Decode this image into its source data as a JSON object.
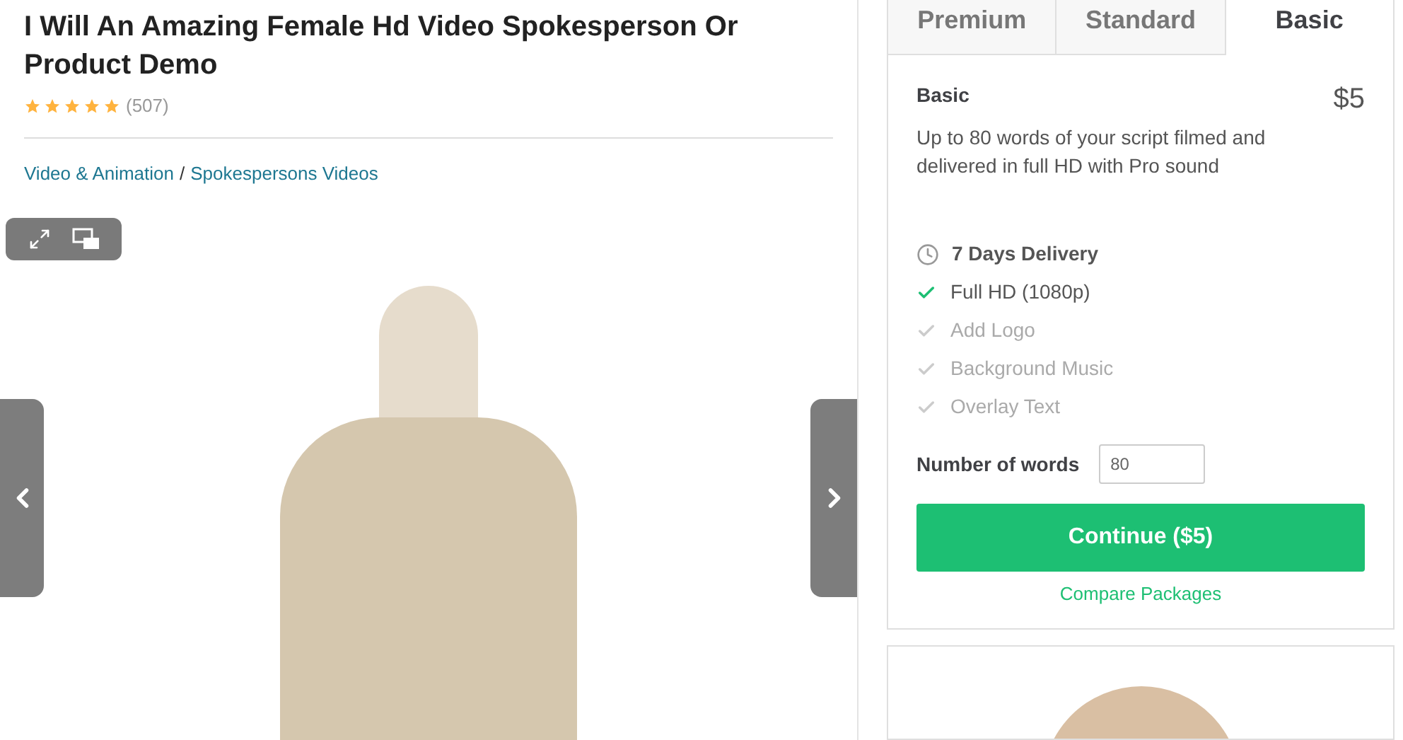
{
  "gig": {
    "title": "I Will An Amazing Female Hd Video Spokesperson Or Product Demo",
    "stars": 5,
    "review_count": "(507)",
    "breadcrumb": [
      {
        "label": "Video & Animation"
      },
      {
        "label": "Spokespersons Videos"
      }
    ],
    "breadcrumb_separator": "/"
  },
  "packages": {
    "tabs": [
      {
        "label": "Premium",
        "selected": false
      },
      {
        "label": "Standard",
        "selected": false
      },
      {
        "label": "Basic",
        "selected": true
      }
    ],
    "name": "Basic",
    "price": "$5",
    "description": "Up to 80 words of your script filmed and delivered in full HD with Pro sound",
    "delivery": "7 Days Delivery",
    "features": [
      {
        "label": "Full HD (1080p)",
        "included": true
      },
      {
        "label": "Add Logo",
        "included": false
      },
      {
        "label": "Background Music",
        "included": false
      },
      {
        "label": "Overlay Text",
        "included": false
      }
    ],
    "words_label": "Number of words",
    "words_value": "80",
    "continue_button": "Continue ($5)",
    "compare_link": "Compare Packages"
  }
}
